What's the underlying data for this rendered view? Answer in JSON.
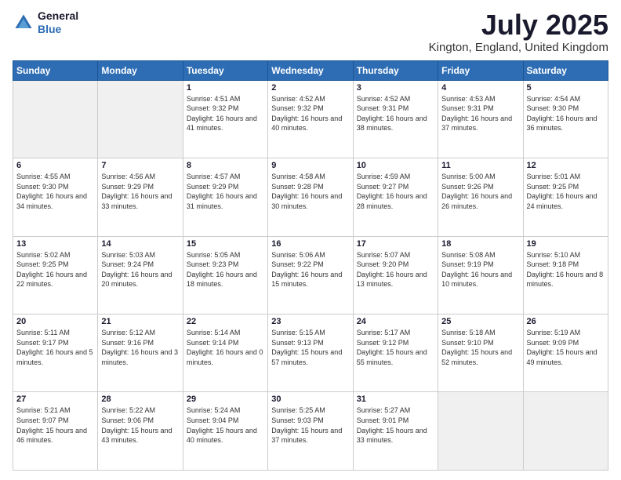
{
  "header": {
    "logo_line1": "General",
    "logo_line2": "Blue",
    "month_title": "July 2025",
    "location": "Kington, England, United Kingdom"
  },
  "days_of_week": [
    "Sunday",
    "Monday",
    "Tuesday",
    "Wednesday",
    "Thursday",
    "Friday",
    "Saturday"
  ],
  "weeks": [
    [
      {
        "day": "",
        "sunrise": "",
        "sunset": "",
        "daylight": "",
        "empty": true
      },
      {
        "day": "",
        "sunrise": "",
        "sunset": "",
        "daylight": "",
        "empty": true
      },
      {
        "day": "1",
        "sunrise": "Sunrise: 4:51 AM",
        "sunset": "Sunset: 9:32 PM",
        "daylight": "Daylight: 16 hours and 41 minutes."
      },
      {
        "day": "2",
        "sunrise": "Sunrise: 4:52 AM",
        "sunset": "Sunset: 9:32 PM",
        "daylight": "Daylight: 16 hours and 40 minutes."
      },
      {
        "day": "3",
        "sunrise": "Sunrise: 4:52 AM",
        "sunset": "Sunset: 9:31 PM",
        "daylight": "Daylight: 16 hours and 38 minutes."
      },
      {
        "day": "4",
        "sunrise": "Sunrise: 4:53 AM",
        "sunset": "Sunset: 9:31 PM",
        "daylight": "Daylight: 16 hours and 37 minutes."
      },
      {
        "day": "5",
        "sunrise": "Sunrise: 4:54 AM",
        "sunset": "Sunset: 9:30 PM",
        "daylight": "Daylight: 16 hours and 36 minutes."
      }
    ],
    [
      {
        "day": "6",
        "sunrise": "Sunrise: 4:55 AM",
        "sunset": "Sunset: 9:30 PM",
        "daylight": "Daylight: 16 hours and 34 minutes."
      },
      {
        "day": "7",
        "sunrise": "Sunrise: 4:56 AM",
        "sunset": "Sunset: 9:29 PM",
        "daylight": "Daylight: 16 hours and 33 minutes."
      },
      {
        "day": "8",
        "sunrise": "Sunrise: 4:57 AM",
        "sunset": "Sunset: 9:29 PM",
        "daylight": "Daylight: 16 hours and 31 minutes."
      },
      {
        "day": "9",
        "sunrise": "Sunrise: 4:58 AM",
        "sunset": "Sunset: 9:28 PM",
        "daylight": "Daylight: 16 hours and 30 minutes."
      },
      {
        "day": "10",
        "sunrise": "Sunrise: 4:59 AM",
        "sunset": "Sunset: 9:27 PM",
        "daylight": "Daylight: 16 hours and 28 minutes."
      },
      {
        "day": "11",
        "sunrise": "Sunrise: 5:00 AM",
        "sunset": "Sunset: 9:26 PM",
        "daylight": "Daylight: 16 hours and 26 minutes."
      },
      {
        "day": "12",
        "sunrise": "Sunrise: 5:01 AM",
        "sunset": "Sunset: 9:25 PM",
        "daylight": "Daylight: 16 hours and 24 minutes."
      }
    ],
    [
      {
        "day": "13",
        "sunrise": "Sunrise: 5:02 AM",
        "sunset": "Sunset: 9:25 PM",
        "daylight": "Daylight: 16 hours and 22 minutes."
      },
      {
        "day": "14",
        "sunrise": "Sunrise: 5:03 AM",
        "sunset": "Sunset: 9:24 PM",
        "daylight": "Daylight: 16 hours and 20 minutes."
      },
      {
        "day": "15",
        "sunrise": "Sunrise: 5:05 AM",
        "sunset": "Sunset: 9:23 PM",
        "daylight": "Daylight: 16 hours and 18 minutes."
      },
      {
        "day": "16",
        "sunrise": "Sunrise: 5:06 AM",
        "sunset": "Sunset: 9:22 PM",
        "daylight": "Daylight: 16 hours and 15 minutes."
      },
      {
        "day": "17",
        "sunrise": "Sunrise: 5:07 AM",
        "sunset": "Sunset: 9:20 PM",
        "daylight": "Daylight: 16 hours and 13 minutes."
      },
      {
        "day": "18",
        "sunrise": "Sunrise: 5:08 AM",
        "sunset": "Sunset: 9:19 PM",
        "daylight": "Daylight: 16 hours and 10 minutes."
      },
      {
        "day": "19",
        "sunrise": "Sunrise: 5:10 AM",
        "sunset": "Sunset: 9:18 PM",
        "daylight": "Daylight: 16 hours and 8 minutes."
      }
    ],
    [
      {
        "day": "20",
        "sunrise": "Sunrise: 5:11 AM",
        "sunset": "Sunset: 9:17 PM",
        "daylight": "Daylight: 16 hours and 5 minutes."
      },
      {
        "day": "21",
        "sunrise": "Sunrise: 5:12 AM",
        "sunset": "Sunset: 9:16 PM",
        "daylight": "Daylight: 16 hours and 3 minutes."
      },
      {
        "day": "22",
        "sunrise": "Sunrise: 5:14 AM",
        "sunset": "Sunset: 9:14 PM",
        "daylight": "Daylight: 16 hours and 0 minutes."
      },
      {
        "day": "23",
        "sunrise": "Sunrise: 5:15 AM",
        "sunset": "Sunset: 9:13 PM",
        "daylight": "Daylight: 15 hours and 57 minutes."
      },
      {
        "day": "24",
        "sunrise": "Sunrise: 5:17 AM",
        "sunset": "Sunset: 9:12 PM",
        "daylight": "Daylight: 15 hours and 55 minutes."
      },
      {
        "day": "25",
        "sunrise": "Sunrise: 5:18 AM",
        "sunset": "Sunset: 9:10 PM",
        "daylight": "Daylight: 15 hours and 52 minutes."
      },
      {
        "day": "26",
        "sunrise": "Sunrise: 5:19 AM",
        "sunset": "Sunset: 9:09 PM",
        "daylight": "Daylight: 15 hours and 49 minutes."
      }
    ],
    [
      {
        "day": "27",
        "sunrise": "Sunrise: 5:21 AM",
        "sunset": "Sunset: 9:07 PM",
        "daylight": "Daylight: 15 hours and 46 minutes."
      },
      {
        "day": "28",
        "sunrise": "Sunrise: 5:22 AM",
        "sunset": "Sunset: 9:06 PM",
        "daylight": "Daylight: 15 hours and 43 minutes."
      },
      {
        "day": "29",
        "sunrise": "Sunrise: 5:24 AM",
        "sunset": "Sunset: 9:04 PM",
        "daylight": "Daylight: 15 hours and 40 minutes."
      },
      {
        "day": "30",
        "sunrise": "Sunrise: 5:25 AM",
        "sunset": "Sunset: 9:03 PM",
        "daylight": "Daylight: 15 hours and 37 minutes."
      },
      {
        "day": "31",
        "sunrise": "Sunrise: 5:27 AM",
        "sunset": "Sunset: 9:01 PM",
        "daylight": "Daylight: 15 hours and 33 minutes."
      },
      {
        "day": "",
        "sunrise": "",
        "sunset": "",
        "daylight": "",
        "empty": true
      },
      {
        "day": "",
        "sunrise": "",
        "sunset": "",
        "daylight": "",
        "empty": true
      }
    ]
  ]
}
